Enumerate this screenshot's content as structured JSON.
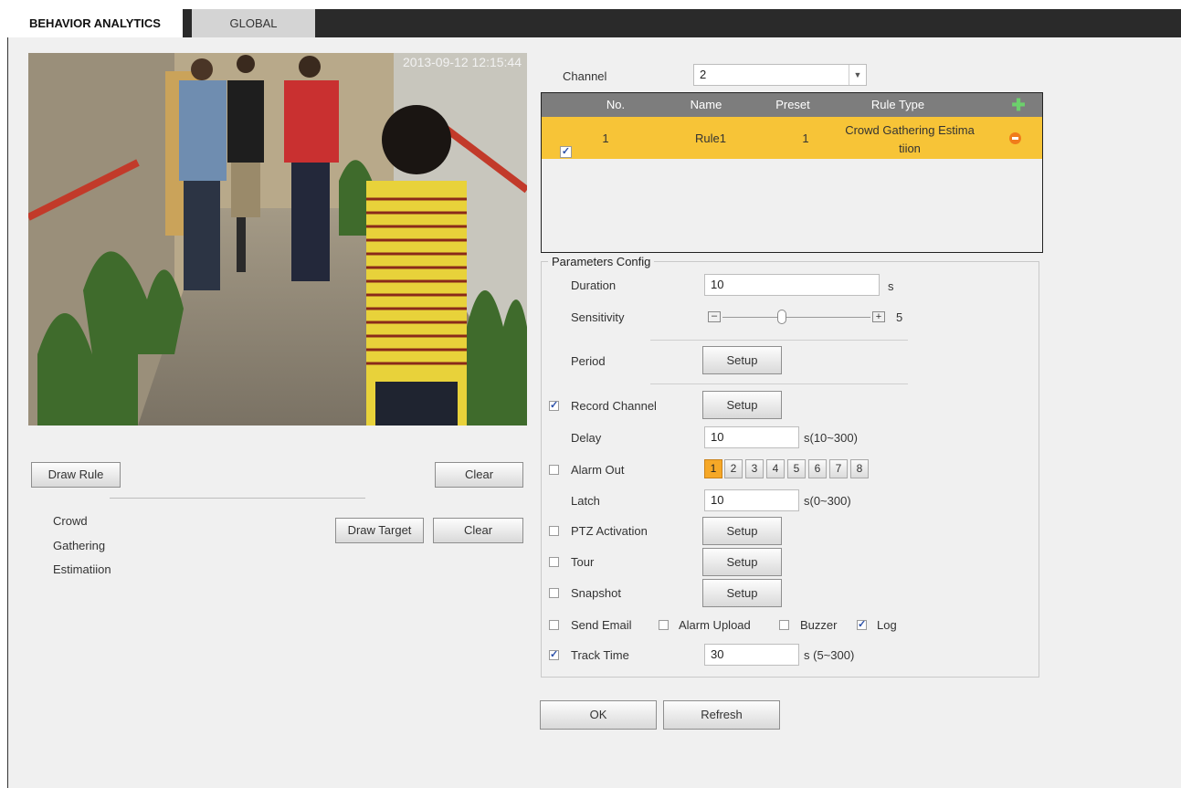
{
  "tabs": {
    "active": "BEHAVIOR ANALYTICS",
    "inactive": "GLOBAL"
  },
  "video": {
    "timestamp": "2013-09-12 12:15:44"
  },
  "left": {
    "draw_rule": "Draw Rule",
    "clear1": "Clear",
    "draw_target": "Draw Target",
    "clear2": "Clear",
    "rule_desc": [
      "Crowd",
      "Gathering",
      "Estimatiion"
    ]
  },
  "channel": {
    "label": "Channel",
    "value": "2"
  },
  "table": {
    "headers": [
      "No.",
      "Name",
      "Preset",
      "Rule Type"
    ],
    "rows": [
      {
        "no": "1",
        "name": "Rule1",
        "preset": "1",
        "type_line1": "Crowd Gathering Estima",
        "type_line2": "tiion",
        "checked": true
      }
    ]
  },
  "params": {
    "legend": "Parameters Config",
    "duration_label": "Duration",
    "duration_value": "10",
    "duration_unit": "s",
    "sensitivity_label": "Sensitivity",
    "sensitivity_value": "5",
    "sensitivity_level": 0.4,
    "period_label": "Period",
    "setup": "Setup",
    "record_label": "Record Channel",
    "record_checked": true,
    "delay_label": "Delay",
    "delay_value": "10",
    "delay_range": "s(10~300)",
    "alarm_out_label": "Alarm Out",
    "alarm_out_checked": false,
    "alarm_outs": [
      "1",
      "2",
      "3",
      "4",
      "5",
      "6",
      "7",
      "8"
    ],
    "alarm_out_selected": "1",
    "latch_label": "Latch",
    "latch_value": "10",
    "latch_range": "s(0~300)",
    "ptz_label": "PTZ Activation",
    "ptz_checked": false,
    "tour_label": "Tour",
    "tour_checked": false,
    "snapshot_label": "Snapshot",
    "snapshot_checked": false,
    "send_email_label": "Send Email",
    "send_email_checked": false,
    "alarm_upload_label": "Alarm Upload",
    "alarm_upload_checked": false,
    "buzzer_label": "Buzzer",
    "buzzer_checked": false,
    "log_label": "Log",
    "log_checked": true,
    "track_label": "Track Time",
    "track_checked": true,
    "track_value": "30",
    "track_range": "s (5~300)"
  },
  "footer": {
    "ok": "OK",
    "refresh": "Refresh"
  },
  "colors": {
    "selected_row": "#f7c437",
    "header": "#7d7d7d",
    "add_icon": "#5cb85c",
    "remove_icon": "#f07c1b"
  }
}
